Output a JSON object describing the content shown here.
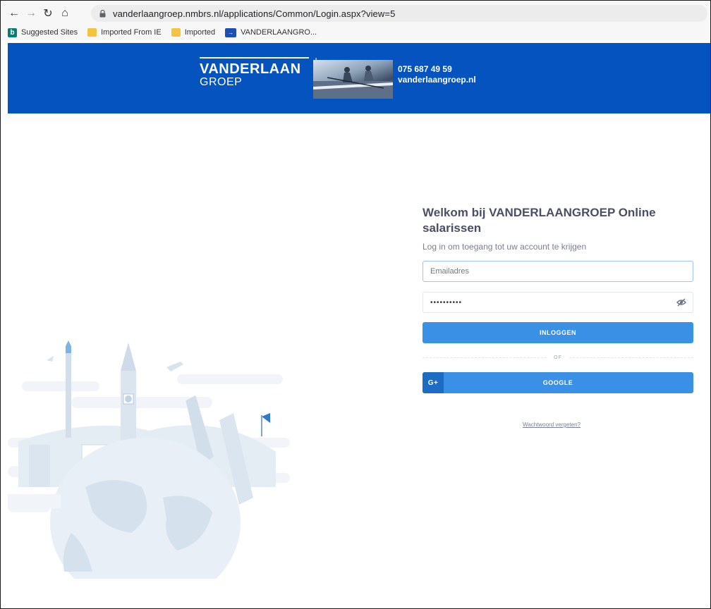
{
  "browser": {
    "url": "vanderlaangroep.nmbrs.nl/applications/Common/Login.aspx?view=5",
    "bookmarks": [
      {
        "label": "Suggested Sites",
        "icon": "bing-icon"
      },
      {
        "label": "Imported From IE",
        "icon": "folder-icon"
      },
      {
        "label": "Imported",
        "icon": "folder-icon"
      },
      {
        "label": "VANDERLAANGRO...",
        "icon": "vanderlaan-favicon"
      }
    ]
  },
  "banner": {
    "logo_main": "VANDERLAAN",
    "logo_sub": "GROEP",
    "logo_plus": "+",
    "phone": "075 687 49 59",
    "website": "vanderlaangroep.nl",
    "background": "#0453bf"
  },
  "login": {
    "title": "Welkom bij VANDERLAANGROEP Online salarissen",
    "subtitle": "Log in om toegang tot uw account te krijgen",
    "email_placeholder": "Emailadres",
    "password_value": "••••••••••",
    "login_button": "INLOGGEN",
    "divider_text": "OF",
    "google_badge": "G+",
    "google_button": "GOOGLE",
    "forgot_link": "Wachtwoord vergeten?",
    "button_color": "#3a90e5"
  }
}
